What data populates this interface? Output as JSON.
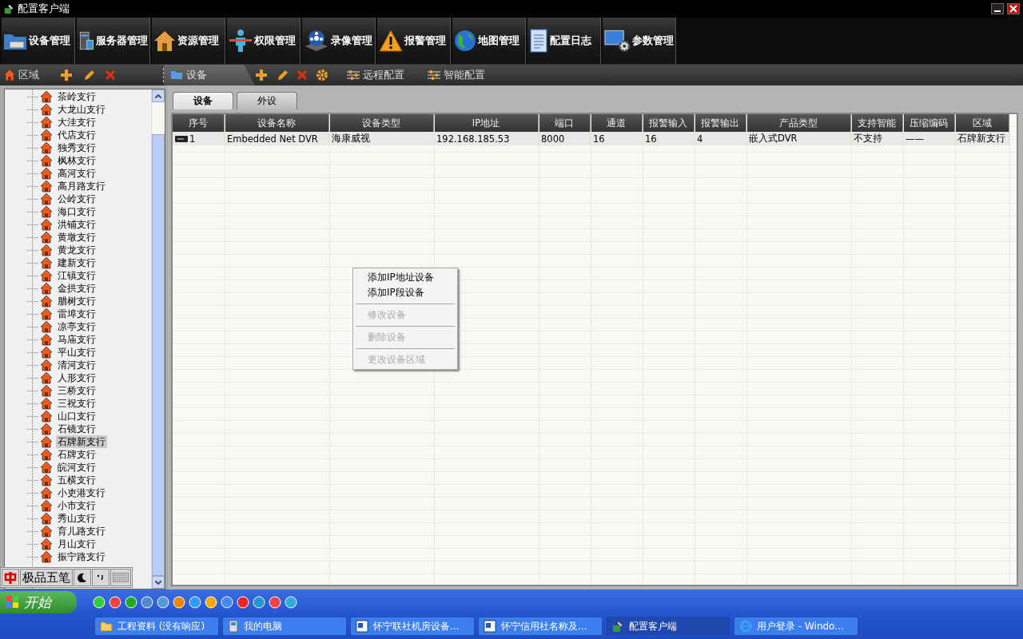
{
  "window": {
    "title": "配置客户端"
  },
  "toolbar": [
    {
      "label": "设备管理",
      "kind": "device"
    },
    {
      "label": "服务器管理",
      "kind": "server"
    },
    {
      "label": "资源管理",
      "kind": "house"
    },
    {
      "label": "权限管理",
      "kind": "person"
    },
    {
      "label": "录像管理",
      "kind": "reel"
    },
    {
      "label": "报警管理",
      "kind": "warning"
    },
    {
      "label": "地图管理",
      "kind": "globe"
    },
    {
      "label": "配置日志",
      "kind": "document"
    },
    {
      "label": "参数管理",
      "kind": "monitor"
    }
  ],
  "area_bar": {
    "title": "区域"
  },
  "device_bar": {
    "title": "设备",
    "actions": [
      "远程配置",
      "智能配置"
    ]
  },
  "tree": {
    "items": [
      {
        "label": "茶岭支行",
        "selected": false
      },
      {
        "label": "大龙山支行",
        "selected": false
      },
      {
        "label": "大洼支行",
        "selected": false
      },
      {
        "label": "代店支行",
        "selected": false
      },
      {
        "label": "独秀支行",
        "selected": false
      },
      {
        "label": "枫林支行",
        "selected": false
      },
      {
        "label": "高河支行",
        "selected": false
      },
      {
        "label": "高月路支行",
        "selected": false
      },
      {
        "label": "公岭支行",
        "selected": false
      },
      {
        "label": "海口支行",
        "selected": false
      },
      {
        "label": "洪铺支行",
        "selected": false
      },
      {
        "label": "黄墩支行",
        "selected": false
      },
      {
        "label": "黄龙支行",
        "selected": false
      },
      {
        "label": "建新支行",
        "selected": false
      },
      {
        "label": "江镇支行",
        "selected": false
      },
      {
        "label": "金拱支行",
        "selected": false
      },
      {
        "label": "腊树支行",
        "selected": false
      },
      {
        "label": "雷埠支行",
        "selected": false
      },
      {
        "label": "凉亭支行",
        "selected": false
      },
      {
        "label": "马庙支行",
        "selected": false
      },
      {
        "label": "平山支行",
        "selected": false
      },
      {
        "label": "清河支行",
        "selected": false
      },
      {
        "label": "人形支行",
        "selected": false
      },
      {
        "label": "三桥支行",
        "selected": false
      },
      {
        "label": "三祝支行",
        "selected": false
      },
      {
        "label": "山口支行",
        "selected": false
      },
      {
        "label": "石镜支行",
        "selected": false
      },
      {
        "label": "石牌新支行",
        "selected": true
      },
      {
        "label": "石牌支行",
        "selected": false
      },
      {
        "label": "皖河支行",
        "selected": false
      },
      {
        "label": "五横支行",
        "selected": false
      },
      {
        "label": "小吏港支行",
        "selected": false
      },
      {
        "label": "小市支行",
        "selected": false
      },
      {
        "label": "秀山支行",
        "selected": false
      },
      {
        "label": "育儿路支行",
        "selected": false
      },
      {
        "label": "月山支行",
        "selected": false
      },
      {
        "label": "振宁路支行",
        "selected": false
      }
    ]
  },
  "tabs": [
    {
      "label": "设备",
      "selected": true
    },
    {
      "label": "外设",
      "selected": false
    }
  ],
  "table": {
    "columns": [
      "序号",
      "设备名称",
      "设备类型",
      "IP地址",
      "端口",
      "通道",
      "报警输入",
      "报警输出",
      "产品类型",
      "支持智能",
      "压缩编码",
      "区域"
    ],
    "rows": [
      {
        "cells": [
          "1",
          "Embedded Net DVR",
          "海康威视",
          "192.168.185.53",
          "8000",
          "16",
          "16",
          "4",
          "嵌入式DVR",
          "不支持",
          "——",
          "石牌新支行"
        ]
      }
    ]
  },
  "context_menu": {
    "groups": [
      [
        {
          "label": "添加IP地址设备",
          "disabled": false
        },
        {
          "label": "添加IP段设备",
          "disabled": false
        }
      ],
      [
        {
          "label": "修改设备",
          "disabled": true
        }
      ],
      [
        {
          "label": "删除设备",
          "disabled": true
        }
      ],
      [
        {
          "label": "更改设备区域",
          "disabled": true
        }
      ]
    ]
  },
  "ime_bar": {
    "label": "极品五笔"
  },
  "taskbar": {
    "start": "开始",
    "tasks": [
      {
        "label": "工程资料 (没有响应)",
        "kind": "folder",
        "selected": false
      },
      {
        "label": "我的电脑",
        "kind": "computer",
        "selected": false
      },
      {
        "label": "怀宁联社机房设备...",
        "kind": "document",
        "selected": false
      },
      {
        "label": "怀宁信用社名称及...",
        "kind": "document",
        "selected": false
      },
      {
        "label": "配置客户端",
        "kind": "app",
        "selected": true
      },
      {
        "label": "用户登录 - Windo...",
        "kind": "browser",
        "selected": false
      }
    ]
  }
}
